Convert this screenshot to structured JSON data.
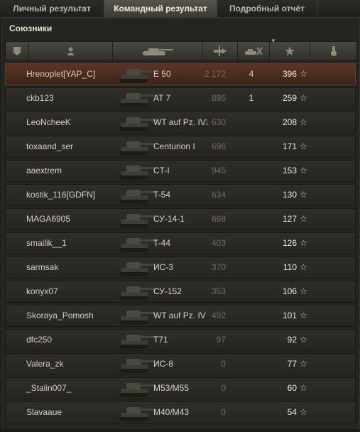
{
  "tabs": [
    {
      "label": "Личный результат",
      "active": false
    },
    {
      "label": "Командный результат",
      "active": true
    },
    {
      "label": "Подробный отчёт",
      "active": false
    }
  ],
  "section_title": "Союзники",
  "columns": [
    "platoon-icon",
    "player-icon",
    "tank-icon",
    "damage-icon",
    "frags-icon",
    "xp-star-icon",
    "medal-icon"
  ],
  "colors": {
    "highlight_row": "#5a3527",
    "frags": "#e4cf86"
  },
  "rows": [
    {
      "player": "Hrenoplet[YAP_C]",
      "tank": "E 50",
      "damage": "2 172",
      "frags": "4",
      "xp": "396",
      "highlight": true
    },
    {
      "player": "ckb123",
      "tank": "AT 7",
      "damage": "895",
      "frags": "1",
      "xp": "259"
    },
    {
      "player": "LeoNcheeK",
      "tank": "WT auf Pz. IV",
      "damage": "1 630",
      "frags": "",
      "xp": "208"
    },
    {
      "player": "toxaand_ser",
      "tank": "Centurion I",
      "damage": "696",
      "frags": "",
      "xp": "171"
    },
    {
      "player": "aaextrem",
      "tank": "CT-I",
      "damage": "945",
      "frags": "",
      "xp": "153"
    },
    {
      "player": "kostik_116[GDFN]",
      "tank": "T-54",
      "damage": "634",
      "frags": "",
      "xp": "130"
    },
    {
      "player": "MAGA6905",
      "tank": "СУ-14-1",
      "damage": "668",
      "frags": "",
      "xp": "127"
    },
    {
      "player": "smailik__1",
      "tank": "T-44",
      "damage": "403",
      "frags": "",
      "xp": "126"
    },
    {
      "player": "sarmsak",
      "tank": "ИС-3",
      "damage": "370",
      "frags": "",
      "xp": "110"
    },
    {
      "player": "konyx07",
      "tank": "СУ-152",
      "damage": "353",
      "frags": "",
      "xp": "106"
    },
    {
      "player": "Skoraya_Pomosh",
      "tank": "WT auf Pz. IV",
      "damage": "492",
      "frags": "",
      "xp": "101"
    },
    {
      "player": "dfc250",
      "tank": "T71",
      "damage": "97",
      "frags": "",
      "xp": "92"
    },
    {
      "player": "Valera_zk",
      "tank": "ИС-8",
      "damage": "0",
      "frags": "",
      "xp": "77"
    },
    {
      "player": "_Stalin007_",
      "tank": "M53/M55",
      "damage": "0",
      "frags": "",
      "xp": "60"
    },
    {
      "player": "Slavaaue",
      "tank": "M40/M43",
      "damage": "0",
      "frags": "",
      "xp": "54"
    }
  ]
}
